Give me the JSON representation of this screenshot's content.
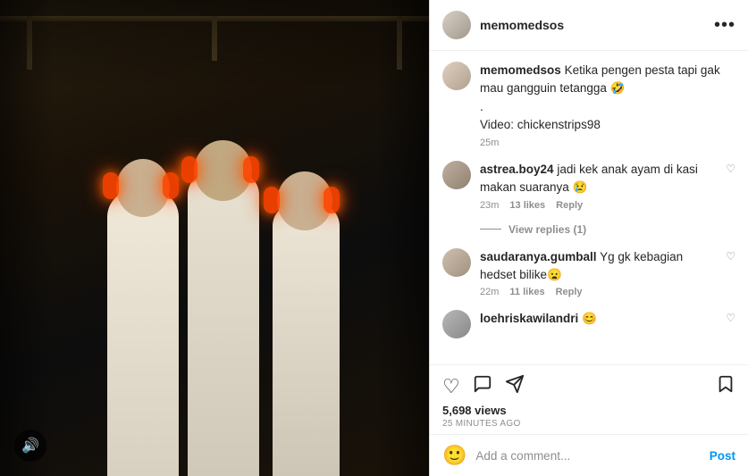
{
  "header": {
    "username": "memomedsos",
    "dots_label": "•••"
  },
  "caption": {
    "username": "memomedsos",
    "text": "Ketika pengen pesta tapi gak mau gangguin tetangga 🤣",
    "extra": ".",
    "video_credit": "Video: chickenstrips98",
    "time": "25m"
  },
  "comments": [
    {
      "id": "comment-1",
      "username": "astrea.boy24",
      "text": "jadi kek anak ayam di kasi makan suaranya 😢",
      "time": "23m",
      "likes": "13 likes",
      "reply": "Reply",
      "view_replies": "View replies (1)"
    },
    {
      "id": "comment-2",
      "username": "saudaranya.gumball",
      "text": "Yg gk kebagian hedset bilike😦",
      "time": "22m",
      "likes": "11 likes",
      "reply": "Reply"
    },
    {
      "id": "comment-3",
      "username": "loehriskawilandri",
      "text": "😊",
      "time": "",
      "likes": "",
      "reply": ""
    }
  ],
  "actions": {
    "views": "5,698 views",
    "time_ago": "25 MINUTES AGO",
    "post_label": "Post"
  },
  "add_comment": {
    "placeholder": "Add a comment...",
    "emoji": "🙂"
  },
  "sound": {
    "icon": "🔊"
  }
}
